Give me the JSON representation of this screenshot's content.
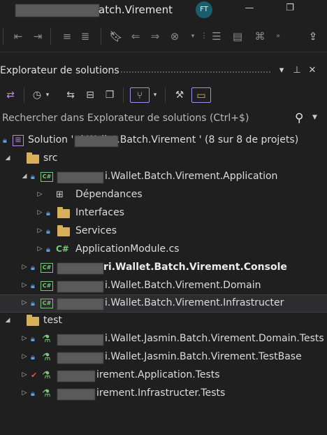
{
  "window": {
    "title_suffix": "atch.Virement",
    "avatar": "FT",
    "minimize": "—",
    "restore": "❐"
  },
  "panel": {
    "title": "Explorateur de solutions",
    "dropdown": "▾",
    "pin": "🖈",
    "close": "✕"
  },
  "search": {
    "placeholder": "Rechercher dans Explorateur de solutions (Ctrl+$)"
  },
  "tree": {
    "solution": "Solution '          ri.Wallet.Batch.Virement ' (8 sur 8 de projets)",
    "src_folder": "src",
    "app_project": "i.Wallet.Batch.Virement.Application",
    "dependencies": "Dépendances",
    "interfaces": "Interfaces",
    "services": "Services",
    "app_module": "ApplicationModule.cs",
    "console_project": "ri.Wallet.Batch.Virement.Console",
    "domain_project": "i.Wallet.Batch.Virement.Domain",
    "infra_project": "i.Wallet.Batch.Virement.Infrastructer",
    "test_folder": "test",
    "domain_tests": "i.Wallet.Jasmin.Batch.Virement.Domain.Tests",
    "testbase": "i.Wallet.Jasmin.Batch.Virement.TestBase",
    "app_tests": "irement.Application.Tests",
    "infra_tests": "irement.Infrastructer.Tests"
  },
  "icons": {
    "expand_open": "◢",
    "expand_closed": "▷",
    "lock": "🔒",
    "csharp_file": "C#",
    "project_tag": "C#",
    "search": "⚲",
    "wrench": "🔧"
  }
}
